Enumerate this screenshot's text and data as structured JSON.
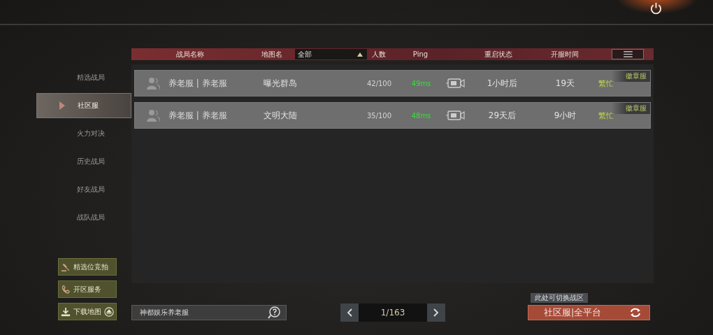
{
  "header": {
    "columns": [
      "战局名称",
      "地图名",
      "人数",
      "Ping",
      "重启状态",
      "开服时间"
    ],
    "map_filter": "全部"
  },
  "sidebar": {
    "items": [
      {
        "label": "精选战局",
        "selected": false
      },
      {
        "label": "社区服",
        "selected": true
      },
      {
        "label": "火力对决",
        "selected": false
      },
      {
        "label": "历史战局",
        "selected": false
      },
      {
        "label": "好友战局",
        "selected": false
      },
      {
        "label": "战队战局",
        "selected": false
      }
    ]
  },
  "rows": [
    {
      "name": "养老服 | 养老服",
      "map": "曝光群岛",
      "players": "42/100",
      "ping": "49ms",
      "restart": "1小时后",
      "uptime": "19天",
      "status": "繁忙",
      "badge": "徽章服"
    },
    {
      "name": "养老服 | 养老服",
      "map": "文明大陆",
      "players": "35/100",
      "ping": "48ms",
      "restart": "29天后",
      "uptime": "9小时",
      "status": "繁忙",
      "badge": "徽章服"
    }
  ],
  "side_buttons": [
    {
      "kind": "auction",
      "label": "精选位竞拍"
    },
    {
      "kind": "service",
      "label": "开区服务"
    },
    {
      "kind": "download",
      "label": "下载地图"
    }
  ],
  "search": {
    "value": "神都娱乐养老服"
  },
  "pager": {
    "page": "1/163"
  },
  "switch": {
    "tooltip": "此处可切换战区",
    "label": "社区服|全平台"
  }
}
